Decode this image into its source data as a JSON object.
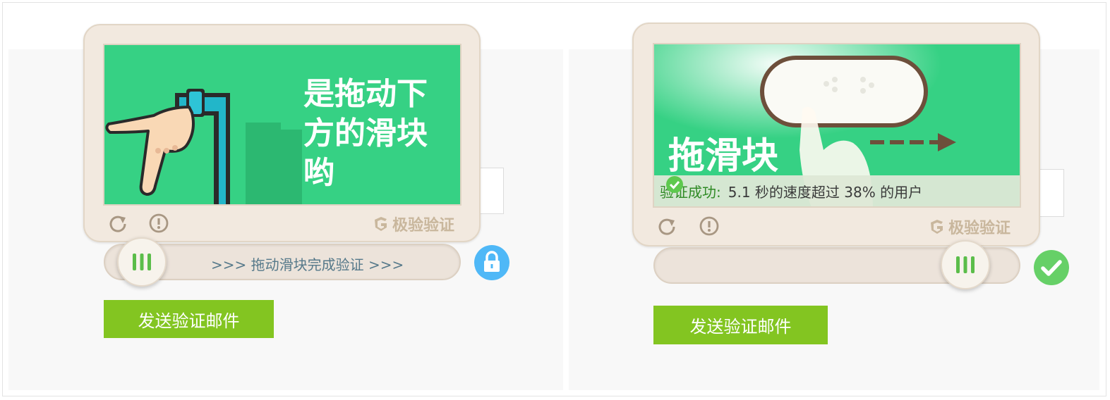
{
  "colors": {
    "image_bg": "#36d184",
    "widget_bg": "#f2e9df",
    "button_green": "#83c521",
    "lock_blue": "#4fb8f7",
    "success_green": "#66d067",
    "brand_tan": "#c9b79d",
    "track_text": "#56798a"
  },
  "left": {
    "image": {
      "caption_lines": [
        "是拖动下",
        "方的滑块",
        "哟"
      ]
    },
    "toolbar": {
      "refresh_icon": "refresh-icon",
      "feedback_icon": "info-icon",
      "brand": "极验验证"
    },
    "slider": {
      "hint": ">>> 拖动滑块完成验证 >>>",
      "state_icon": "lock-icon",
      "progress": 0
    },
    "send_button": "发送验证邮件"
  },
  "right": {
    "image": {
      "caption": "拖滑块"
    },
    "success": {
      "icon": "check-circle-icon",
      "label": "验证成功:",
      "detail": "5.1 秒的速度超过 38% 的用户"
    },
    "toolbar": {
      "refresh_icon": "refresh-icon",
      "feedback_icon": "info-icon",
      "brand": "极验验证"
    },
    "slider": {
      "state_icon": "check-circle-icon",
      "progress": 1
    },
    "send_button": "发送验证邮件"
  }
}
